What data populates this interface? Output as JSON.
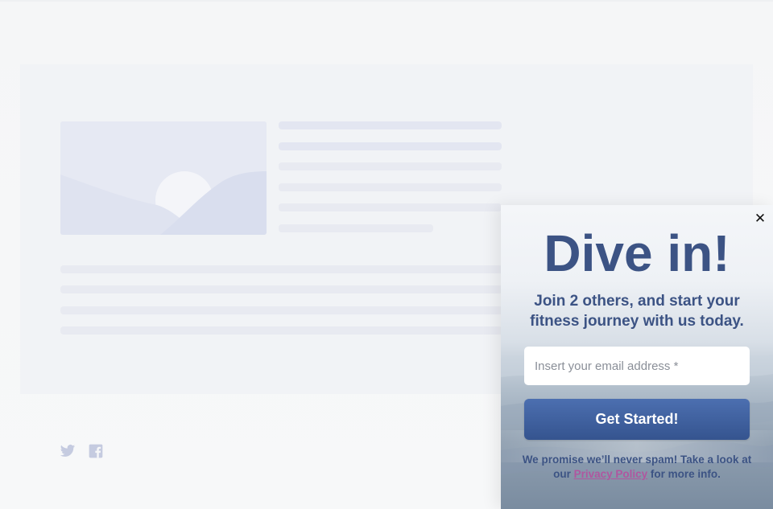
{
  "background": {
    "colors": {
      "page": "#f6f7f8",
      "card": "#f1f3f6",
      "skeleton": "#e3e6f1",
      "image_placeholder": "#e6e9f3"
    },
    "social": {
      "twitter_icon": "twitter-icon",
      "facebook_icon": "facebook-icon",
      "icon_color": "#c5cbe0"
    }
  },
  "popup": {
    "close_label": "✕",
    "title": "Dive in!",
    "subtitle": "Join 2 others, and start your fitness journey with us today.",
    "email_placeholder": "Insert your email address *",
    "email_value": "",
    "cta_label": "Get Started!",
    "promise_before": "We promise we’ll never spam! Take a look at our",
    "privacy_link": "Privacy Policy",
    "promise_after": "for more info.",
    "colors": {
      "text": "#3c5384",
      "button": "#3f5f9e",
      "link": "#b0569f",
      "input_bg": "#ffffff"
    }
  }
}
